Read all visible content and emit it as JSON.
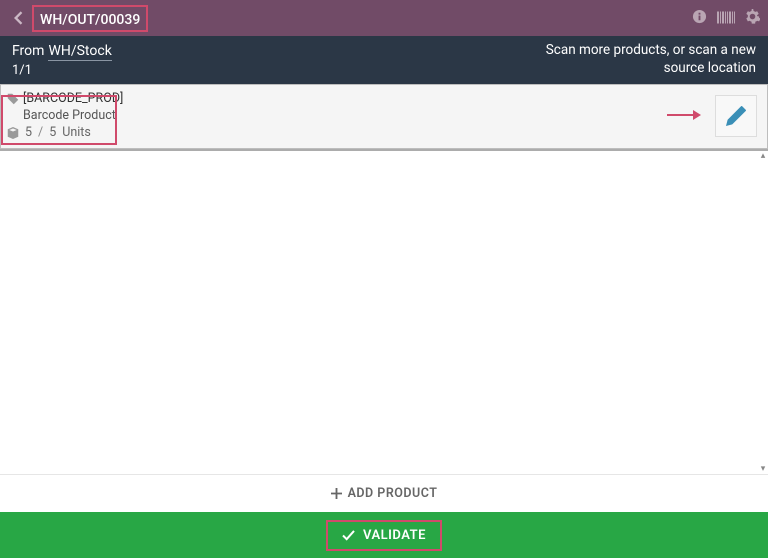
{
  "topbar": {
    "title": "WH/OUT/00039"
  },
  "subheader": {
    "from_label": "From",
    "from_location": "WH/Stock",
    "counter": "1/1",
    "hint_line1": "Scan more products, or scan a new",
    "hint_line2": "source location"
  },
  "line": {
    "code": "[BARCODE_PROD]",
    "name": "Barcode Product",
    "qty_done": "5",
    "qty_sep": "/",
    "qty_total": "5",
    "uom": "Units"
  },
  "footer": {
    "add_label": "ADD PRODUCT",
    "validate_label": "VALIDATE"
  },
  "icons": {
    "back": "chevron-left-icon",
    "info": "info-circle-icon",
    "barcode": "barcode-icon",
    "gear": "gear-icon",
    "tag": "tag-icon",
    "package": "package-icon",
    "edit": "pencil-icon",
    "plus": "plus-icon",
    "check": "check-icon",
    "arrow": "arrow-right-icon"
  },
  "colors": {
    "brand": "#714B67",
    "dark": "#2b3746",
    "success": "#28a745",
    "highlight": "#d04a6b",
    "edit_icon": "#3a8fb7"
  }
}
